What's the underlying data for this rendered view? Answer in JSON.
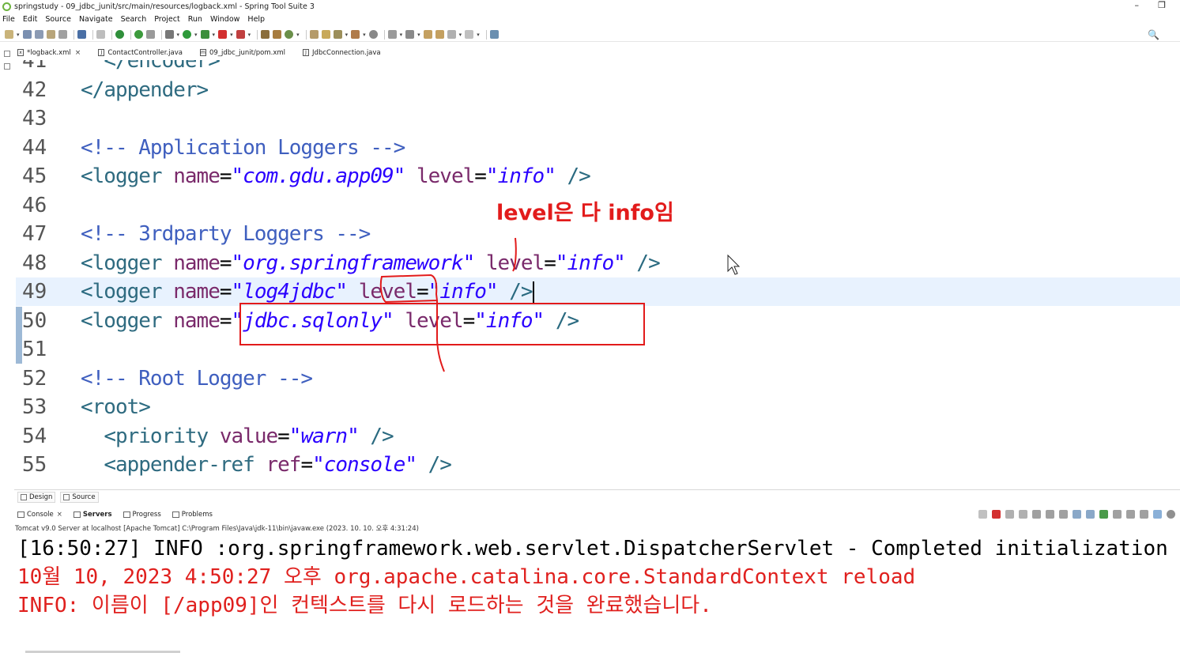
{
  "window": {
    "title": "springstudy - 09_jdbc_junit/src/main/resources/logback.xml - Spring Tool Suite 3",
    "minimize_glyph": "–",
    "restore_glyph": "❐"
  },
  "menu": [
    "File",
    "Edit",
    "Source",
    "Navigate",
    "Search",
    "Project",
    "Run",
    "Window",
    "Help"
  ],
  "toolbar": {
    "search_glyph": "🔍"
  },
  "editor_tabs": [
    {
      "label": "*logback.xml",
      "icon": "xml-file-icon",
      "glyph": "x",
      "closable": true
    },
    {
      "label": "ContactController.java",
      "icon": "java-file-icon",
      "glyph": "J",
      "closable": false
    },
    {
      "label": "09_jdbc_junit/pom.xml",
      "icon": "pom-file-icon",
      "glyph": "m",
      "closable": false
    },
    {
      "label": "JdbcConnection.java",
      "icon": "java-file-icon",
      "glyph": "J",
      "closable": false
    }
  ],
  "code_lines": [
    {
      "number": "41",
      "text": "  </encoder>"
    },
    {
      "number": "42",
      "text": "</appender>"
    },
    {
      "number": "43",
      "text": ""
    },
    {
      "number": "44",
      "text": "<!-- Application Loggers -->"
    },
    {
      "number": "45",
      "text": "<logger name=\"com.gdu.app09\" level=\"info\" />"
    },
    {
      "number": "46",
      "text": ""
    },
    {
      "number": "47",
      "text": "<!-- 3rdparty Loggers -->"
    },
    {
      "number": "48",
      "text": "<logger name=\"org.springframework\" level=\"info\" />"
    },
    {
      "number": "49",
      "text": "<logger name=\"log4jdbc\" level=\"info\" />"
    },
    {
      "number": "50",
      "text": "<logger name=\"jdbc.sqlonly\" level=\"info\" />"
    },
    {
      "number": "51",
      "text": ""
    },
    {
      "number": "52",
      "text": "<!-- Root Logger -->"
    },
    {
      "number": "53",
      "text": "<root>"
    },
    {
      "number": "54",
      "text": "  <priority value=\"warn\" />"
    },
    {
      "number": "55",
      "text": "  <appender-ref ref=\"console\" />"
    }
  ],
  "annotation": {
    "text": "level은 다 info임",
    "color": "#e21b1b"
  },
  "design_tabs": [
    "Design",
    "Source"
  ],
  "console": {
    "tabs": [
      {
        "label": "Console",
        "bold": false,
        "closable": true
      },
      {
        "label": "Servers",
        "bold": true,
        "closable": false
      },
      {
        "label": "Progress",
        "bold": false,
        "closable": false
      },
      {
        "label": "Problems",
        "bold": false,
        "closable": false
      }
    ],
    "info": "Tomcat v9.0 Server at localhost [Apache Tomcat] C:\\Program Files\\Java\\jdk-11\\bin\\javaw.exe  (2023. 10. 10. 오후 4:31:24)",
    "lines": [
      {
        "text": "[16:50:27] INFO :org.springframework.web.servlet.DispatcherServlet - Completed initialization",
        "color": "black"
      },
      {
        "text": "10월 10, 2023 4:50:27 오후 org.apache.catalina.core.StandardContext reload",
        "color": "red"
      },
      {
        "text": "INFO: 이름이 [/app09]인 컨텍스트를 다시 로드하는 것을 완료했습니다.",
        "color": "red"
      }
    ]
  },
  "colors": {
    "accent_red": "#e21b1b",
    "current_line": "#e8f2fe",
    "xml_value": "#2a00ff",
    "xml_comment": "#3f5fbf"
  }
}
